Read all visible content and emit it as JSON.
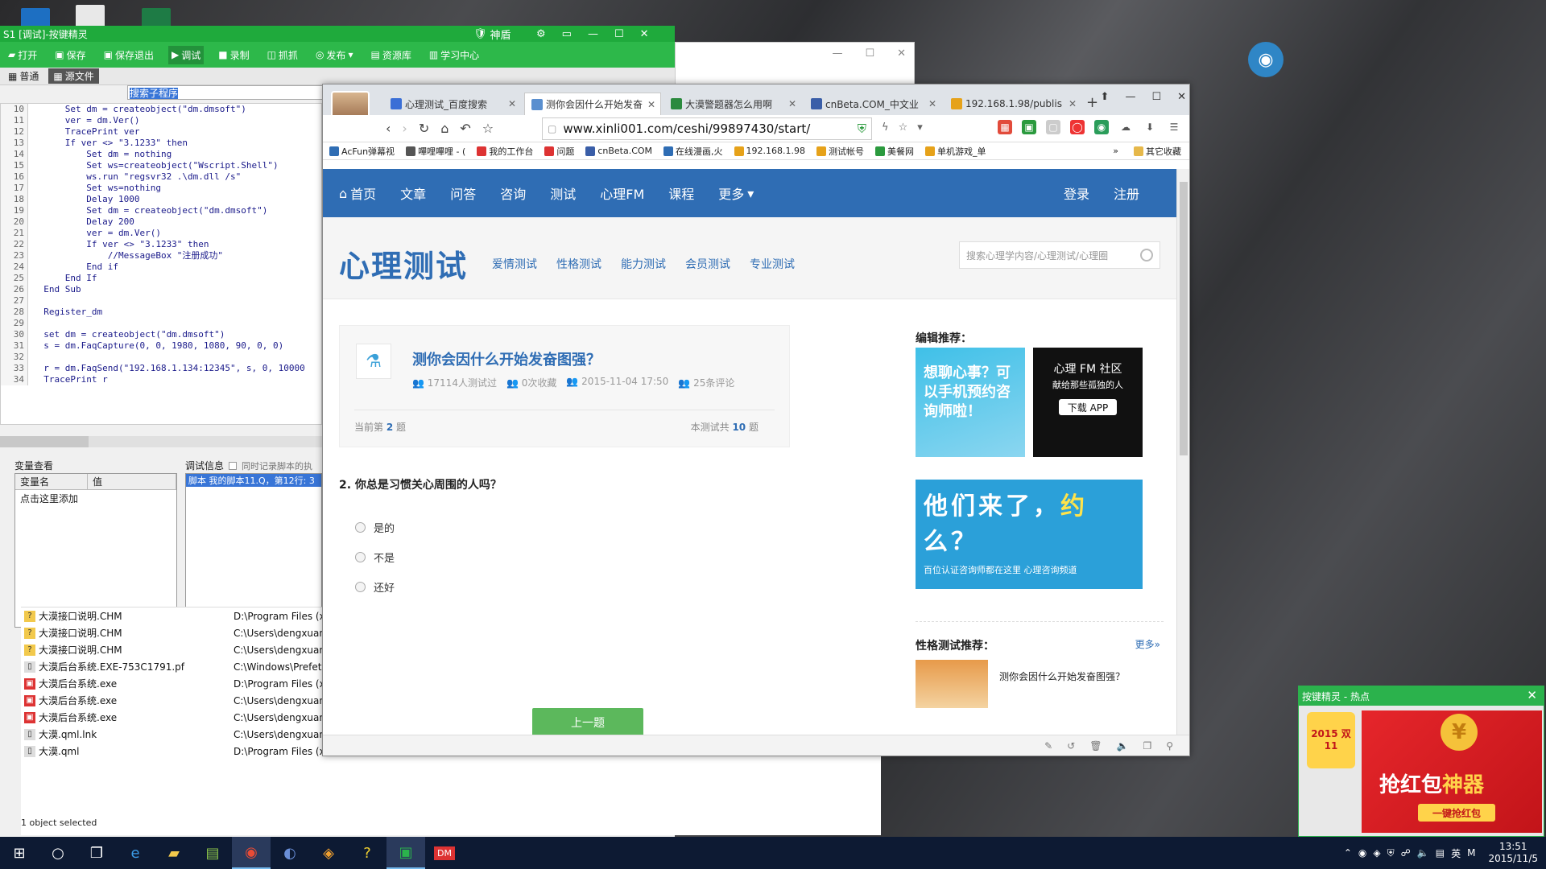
{
  "ide": {
    "title": "S1 [调试]-按键精灵",
    "vip_label": "神盾",
    "toolbar": [
      "打开",
      "保存",
      "保存退出",
      "调试",
      "录制",
      "抓抓",
      "发布",
      "资源库",
      "学习中心"
    ],
    "tabs": [
      "普通",
      "源文件"
    ],
    "search_value": "搜索子程序",
    "code_lines": [
      {
        "n": "10",
        "t": "      Set dm = createobject(\"dm.dmsoft\")"
      },
      {
        "n": "11",
        "t": "      ver = dm.Ver()"
      },
      {
        "n": "12",
        "t": "      TracePrint ver"
      },
      {
        "n": "13",
        "t": "      If ver <> \"3.1233\" then"
      },
      {
        "n": "14",
        "t": "          Set dm = nothing"
      },
      {
        "n": "15",
        "t": "          Set ws=createobject(\"Wscript.Shell\")"
      },
      {
        "n": "16",
        "t": "          ws.run \"regsvr32 .\\dm.dll /s\""
      },
      {
        "n": "17",
        "t": "          Set ws=nothing"
      },
      {
        "n": "18",
        "t": "          Delay 1000"
      },
      {
        "n": "19",
        "t": "          Set dm = createobject(\"dm.dmsoft\")"
      },
      {
        "n": "20",
        "t": "          Delay 200"
      },
      {
        "n": "21",
        "t": "          ver = dm.Ver()"
      },
      {
        "n": "22",
        "t": "          If ver <> \"3.1233\" then"
      },
      {
        "n": "23",
        "t": "              //MessageBox \"注册成功\""
      },
      {
        "n": "24",
        "t": "          End if"
      },
      {
        "n": "25",
        "t": "      End If"
      },
      {
        "n": "26",
        "t": "  End Sub"
      },
      {
        "n": "27",
        "t": ""
      },
      {
        "n": "28",
        "t": "  Register_dm"
      },
      {
        "n": "29",
        "t": ""
      },
      {
        "n": "30",
        "t": "  set dm = createobject(\"dm.dmsoft\")"
      },
      {
        "n": "31",
        "t": "  s = dm.FaqCapture(0, 0, 1980, 1080, 90, 0, 0)"
      },
      {
        "n": "32",
        "t": ""
      },
      {
        "n": "33",
        "t": "  r = dm.FaqSend(\"192.168.1.134:12345\", s, 0, 10000"
      },
      {
        "n": "34",
        "t": "  TracePrint r"
      }
    ],
    "var_label": "变量查看",
    "var_headers": [
      "变量名",
      "值"
    ],
    "var_add": "点击这里添加",
    "debug_label": "调试信息",
    "debug_check": "同时记录脚本的执",
    "debug_line": "脚本 我的脚本11.Q，第12行: 3"
  },
  "explorer": {
    "files": [
      {
        "name": "大漠接口说明.CHM",
        "path": "D:\\Program Files (x"
      },
      {
        "name": "大漠接口说明.CHM",
        "path": "C:\\Users\\dengxuan"
      },
      {
        "name": "大漠接口说明.CHM",
        "path": "C:\\Users\\dengxuan"
      },
      {
        "name": "大漠后台系统.EXE-753C1791.pf",
        "path": "C:\\Windows\\Prefetc"
      },
      {
        "name": "大漠后台系统.exe",
        "path": "D:\\Program Files (x"
      },
      {
        "name": "大漠后台系统.exe",
        "path": "C:\\Users\\dengxuan"
      },
      {
        "name": "大漠后台系统.exe",
        "path": "C:\\Users\\dengxuan"
      },
      {
        "name": "大漠.qml.lnk",
        "path": "C:\\Users\\dengxuan"
      },
      {
        "name": "大漠.qml",
        "path": "D:\\Program Files (x"
      }
    ],
    "status": "1 object selected"
  },
  "browser": {
    "tabs": [
      "心理测试_百度搜索",
      "测你会因什么开始发奋",
      "大漠警题器怎么用啊",
      "cnBeta.COM_中文业",
      "192.168.1.98/publis"
    ],
    "url": "www.xinli001.com/ceshi/99897430/start/",
    "bookmarks": [
      "AcFun弹幕视",
      "嗶哩嗶哩 - (",
      "我的工作台",
      "问题",
      "cnBeta.COM",
      "在线漫画,火",
      "192.168.1.98",
      "测试帐号",
      "美餐网",
      "单机游戏_单"
    ],
    "bookmarks_more": "»",
    "bookmarks_other": "其它收藏"
  },
  "site": {
    "nav": [
      "首页",
      "文章",
      "问答",
      "咨询",
      "测试",
      "心理FM",
      "课程",
      "更多"
    ],
    "login": "登录",
    "register": "注册",
    "logo": "心理测试",
    "cats": [
      "爱情测试",
      "性格测试",
      "能力测试",
      "会员测试",
      "专业测试"
    ],
    "search_placeholder": "搜索心理学内容/心理测试/心理圈",
    "quiz": {
      "title": "测你会因什么开始发奋图强？",
      "takers": "17114人测试过",
      "favs": "0次收藏",
      "date": "2015-11-04 17:50",
      "comments": "25条评论",
      "current_prefix": "当前第",
      "current": "2",
      "current_suffix": "题",
      "total_prefix": "本测试共",
      "total": "10",
      "total_suffix": "题",
      "question": "2. 你总是习惯关心周围的人吗？",
      "options": [
        "是的",
        "不是",
        "还好"
      ],
      "prev": "上一题"
    },
    "sidebar": {
      "editor_pick": "编辑推荐：",
      "ad1": "想聊心事？可以手机预约咨询师啦！",
      "ad2_title": "心理 FM 社区",
      "ad2_sub": "献给那些孤独的人",
      "ad2_btn": "下载 APP",
      "ad3_big_pre": "他们来了，",
      "ad3_big_hl": "约",
      "ad3_big_post": "么？",
      "ad3_small": "百位认证咨询师都在这里 心理咨询频道",
      "personality": "性格测试推荐：",
      "more": "更多»",
      "item": "测你会因什么开始发奋图强？"
    }
  },
  "popup": {
    "title": "按键精灵 - 热点",
    "badge": "2015 双11",
    "main_pre": "抢红包",
    "main_hl": "神器",
    "button": "一键抢红包"
  },
  "taskbar": {
    "time": "13:51",
    "date": "2015/11/5",
    "ime": "英"
  }
}
